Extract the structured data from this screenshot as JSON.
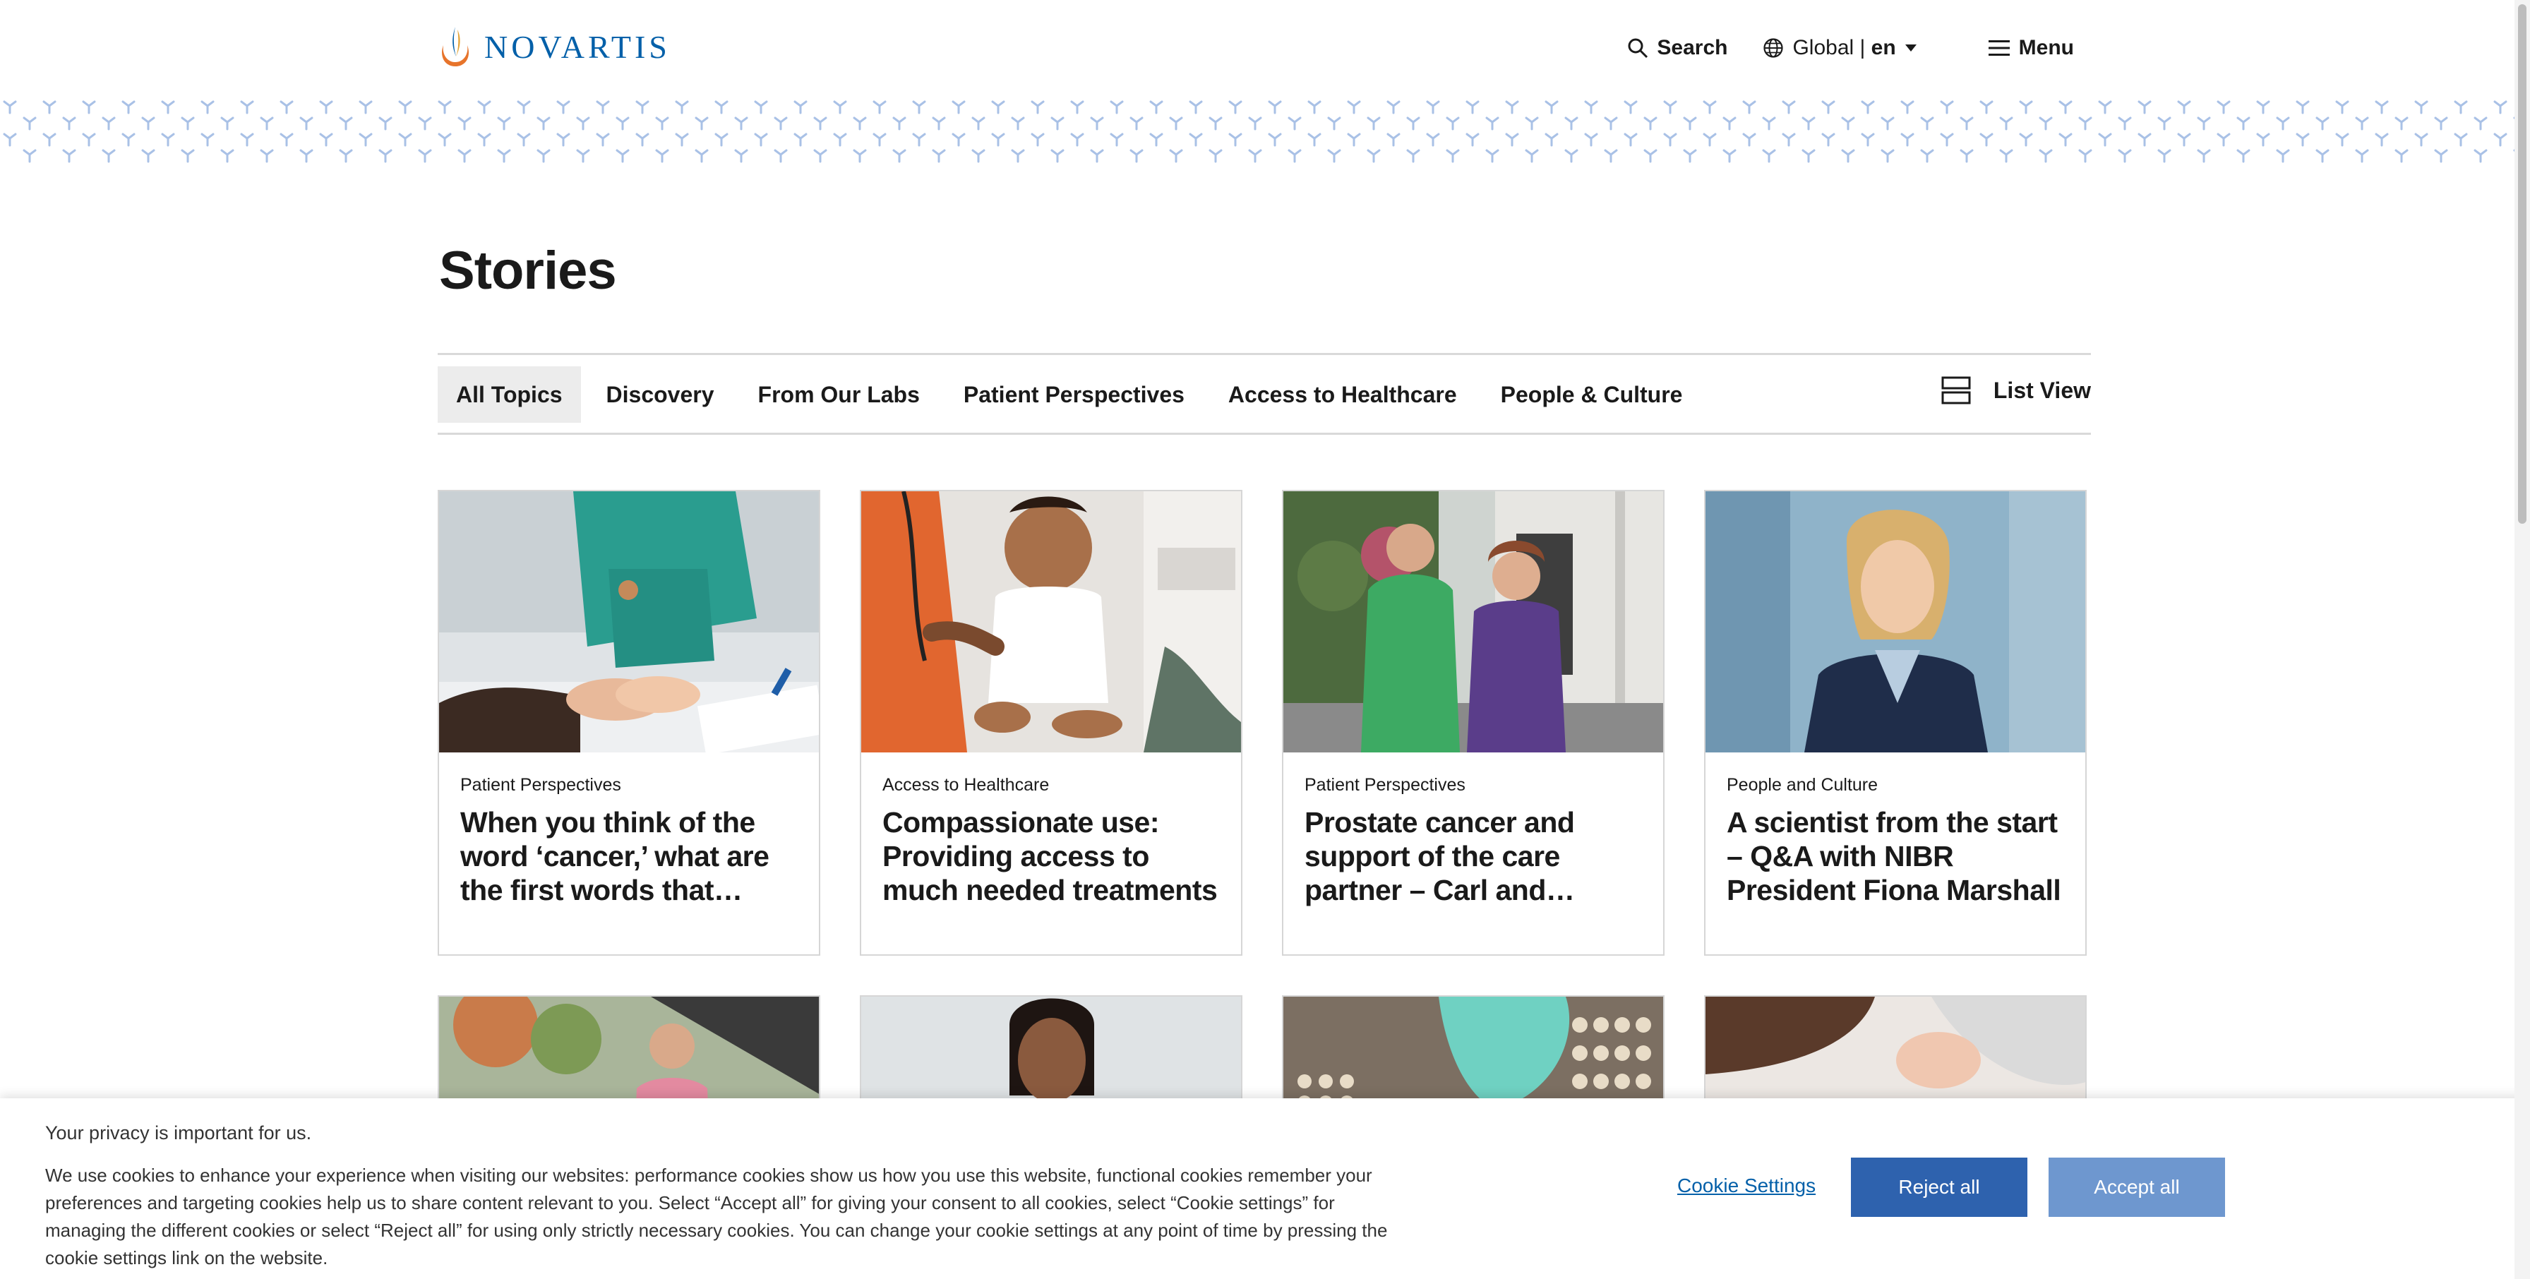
{
  "header": {
    "brand": "NOVARTIS",
    "search_label": "Search",
    "region_label": "Global | ",
    "language": "en",
    "menu_label": "Menu"
  },
  "page": {
    "title": "Stories"
  },
  "tabs": [
    {
      "label": "All Topics",
      "active": true
    },
    {
      "label": "Discovery"
    },
    {
      "label": "From Our Labs"
    },
    {
      "label": "Patient Perspectives"
    },
    {
      "label": "Access to Healthcare"
    },
    {
      "label": "People & Culture"
    }
  ],
  "view_toggle": {
    "label": "List View"
  },
  "cards": [
    {
      "category": "Patient Perspectives",
      "title": "When you think of the word ‘cancer,’ what are the first words that spring to mind?"
    },
    {
      "category": "Access to Healthcare",
      "title": "Compassionate use: Providing access to much needed treatments"
    },
    {
      "category": "Patient Perspectives",
      "title": "Prostate cancer and sup­port of the care partner – Carl and Arlene’s story"
    },
    {
      "category": "People and Culture",
      "title": "A scientist from the start – Q&A with NIBR President Fiona Marshall"
    }
  ],
  "cookie": {
    "heading": "Your privacy is important for us.",
    "body": "We use cookies to enhance your experience when visiting our websites: performance cookies show us how you use this website, functional cookies remember your preferences and targeting cookies help us to share content relevant to you. Select “Accept all” for giving your consent to all cookies, select “Cookie settings” for managing the different cookies or select “Reject all” for using only strictly necessary cookies. You can change your cookie settings at any point of time by pressing the cookie settings link on the website.",
    "settings_label": "Cookie Settings",
    "reject_label": "Reject all",
    "accept_label": "Accept all"
  },
  "colors": {
    "brand_blue": "#0460a9",
    "reject_button": "#2e62ae",
    "accept_button": "#6e97cf",
    "pattern": "#a9c1e6"
  }
}
